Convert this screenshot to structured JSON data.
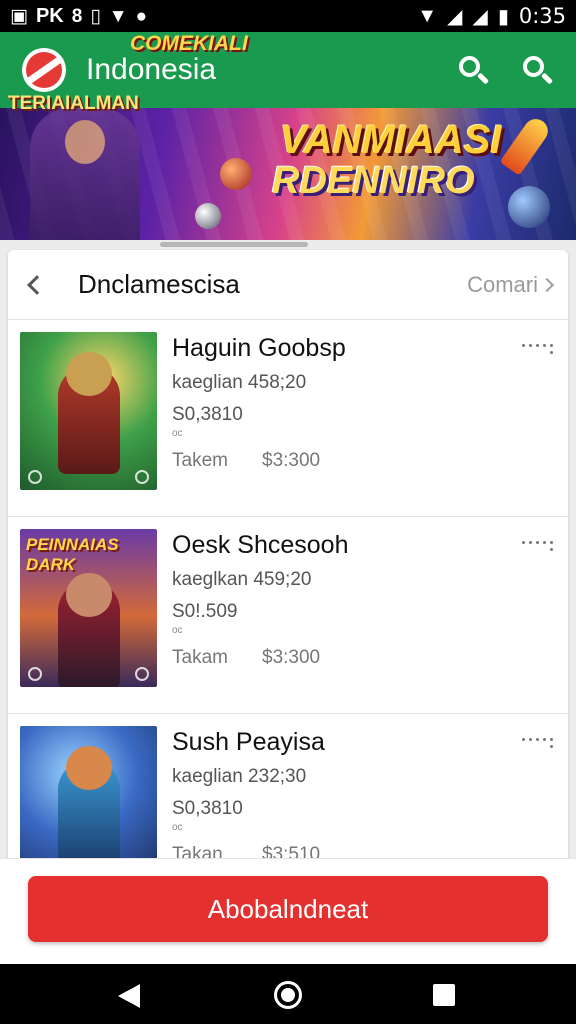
{
  "status_bar": {
    "left_text": "PK",
    "time": "0:35",
    "icons": [
      "notification-icon",
      "wifi-icon",
      "signal-icon",
      "battery-icon"
    ]
  },
  "app_bar": {
    "title": "Indonesia",
    "icons": [
      "search-icon",
      "search-icon"
    ],
    "color": "#1a9a4e"
  },
  "banner": {
    "text_small": "COMEKIALI",
    "text_left": "TERIAIALMAN",
    "title_line1": "VANMIAASI",
    "title_line2": "RDENNIRO"
  },
  "list_card": {
    "title": "Dnclamescisa",
    "link": "Comari",
    "items": [
      {
        "thumb_title": "",
        "name": "Haguin Goobsp",
        "meta": "kaeglian  458;20",
        "price": "S0,3810",
        "tiny": "oc",
        "taken_label": "Takem",
        "total": "$3:300"
      },
      {
        "thumb_title": "PEINNAIAS DARK",
        "name": "Oesk Shcesooh",
        "meta": "kaeglkan  459;20",
        "price": "S0!.509",
        "tiny": "oc",
        "taken_label": "Takam",
        "total": "$3:300"
      },
      {
        "thumb_title": "",
        "name": "Sush Peayisa",
        "meta": "kaeglian  232;30",
        "price": "S0,3810",
        "tiny": "oc",
        "taken_label": "Takan",
        "total": "$3:510"
      }
    ]
  },
  "cta": {
    "label": "Abobalndneat",
    "color": "#e53030"
  },
  "nav_bar": {
    "icons": [
      "back-icon",
      "home-icon",
      "recents-icon"
    ]
  }
}
